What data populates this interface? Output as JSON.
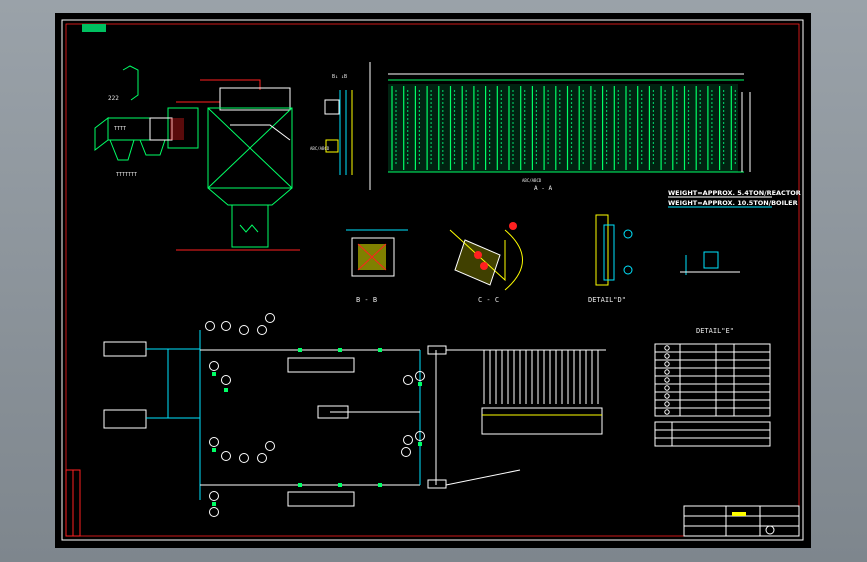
{
  "drawing": {
    "weight_note_1": "WEIGHT=APPROX. 5.4TON/REACTOR",
    "weight_note_2": "WEIGHT=APPROX. 10.5TON/BOILER",
    "section_bb": "B - B",
    "section_cc": "C - C",
    "detail_d": "DETAIL\"D\"",
    "detail_e": "DETAIL\"E\"",
    "section_aa": "A - A",
    "label_222": "222",
    "label_tttt": "TTTT",
    "label_ttttttt": "TTTTTTT"
  },
  "colors": {
    "background": "#000000",
    "frame": "#ffffff",
    "cyan": "#00e5ff",
    "green": "#00ff66",
    "yellow": "#ffff00",
    "red": "#ff2020",
    "white": "#ffffff"
  }
}
